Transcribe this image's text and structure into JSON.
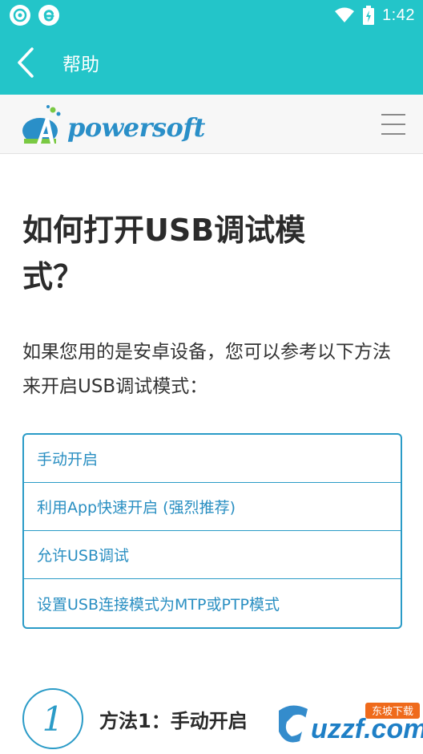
{
  "status_bar": {
    "time": "1:42",
    "icons": [
      "app-icon-1",
      "e-browser-icon",
      "wifi-icon",
      "battery-charging-icon"
    ]
  },
  "app_bar": {
    "back_icon": "chevron-left-icon",
    "title": "帮助"
  },
  "site_header": {
    "logo_text": "powersoft",
    "logo_letter": "A",
    "menu_icon": "hamburger-menu-icon"
  },
  "article": {
    "title": "如何打开USB调试模式？",
    "intro": "如果您用的是安卓设备，您可以参考以下方法来开启USB调试模式：",
    "toc": [
      {
        "label": "手动开启"
      },
      {
        "label": "利用App快速开启 (强烈推荐)"
      },
      {
        "label": "允许USB调试"
      },
      {
        "label": "设置USB连接模式为MTP或PTP模式"
      }
    ],
    "method1": {
      "number": "1",
      "title": "方法1：手动开启"
    }
  },
  "watermark": {
    "text": "uzzf.com",
    "badge": "东坡下载"
  },
  "colors": {
    "teal_bar": "#23c5c9",
    "link_blue": "#2a8fc2",
    "border_blue": "#2a9bc7",
    "logo_blue": "#2a8fc8"
  }
}
